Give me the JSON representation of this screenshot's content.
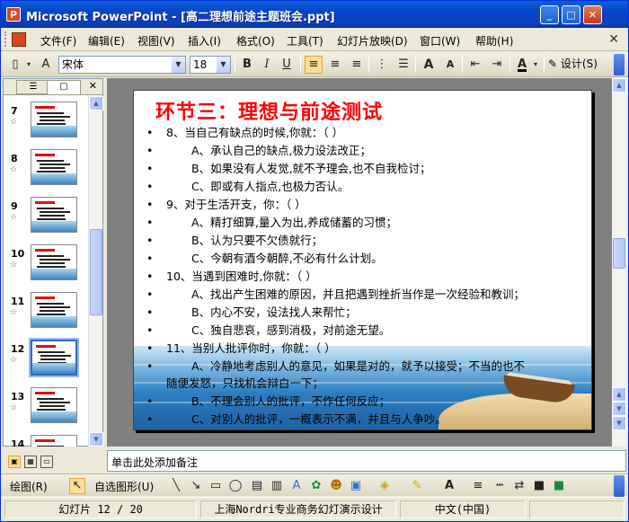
{
  "window": {
    "title": "Microsoft PowerPoint - [高二理想前途主题班会.ppt]",
    "controls": {
      "minimize": "_",
      "restore": "□",
      "close": "✕"
    }
  },
  "menu": {
    "items": [
      "文件(F)",
      "编辑(E)",
      "视图(V)",
      "插入(I)",
      "格式(O)",
      "工具(T)",
      "幻灯片放映(D)",
      "窗口(W)",
      "帮助(H)"
    ],
    "close_doc": "✕"
  },
  "toolbar": {
    "font_name": "宋体",
    "font_size": "18",
    "bold": "B",
    "italic": "I",
    "underline": "U",
    "design_label": "设计(S)"
  },
  "outline_pane": {
    "tab_outline": "☰",
    "tab_slides": "▢",
    "close": "✕",
    "thumbnails": [
      {
        "num": "7"
      },
      {
        "num": "8"
      },
      {
        "num": "9"
      },
      {
        "num": "10"
      },
      {
        "num": "11"
      },
      {
        "num": "12",
        "selected": true
      },
      {
        "num": "13"
      },
      {
        "num": "14"
      }
    ]
  },
  "slide": {
    "title": "环节三：理想与前途测试",
    "lines": [
      {
        "bullet": "•",
        "indent": 0,
        "text": "8、当自己有缺点的时候,你就：（  ）"
      },
      {
        "bullet": "•",
        "indent": 1,
        "text": "A、承认自己的缺点,极力设法改正；"
      },
      {
        "bullet": "•",
        "indent": 1,
        "text": "B、如果没有人发觉,就不予理会,也不自我检讨；"
      },
      {
        "bullet": "•",
        "indent": 1,
        "text": "C、即或有人指点,也极力否认。"
      },
      {
        "bullet": "•",
        "indent": 0,
        "text": "9、对于生活开支，你：（  ）"
      },
      {
        "bullet": "•",
        "indent": 1,
        "text": "A、精打细算,量入为出,养成储蓄的习惯；"
      },
      {
        "bullet": "•",
        "indent": 1,
        "text": "B、认为只要不欠债就行；"
      },
      {
        "bullet": "•",
        "indent": 1,
        "text": "C、今朝有酒今朝醉,不必有什么计划。"
      },
      {
        "bullet": "•",
        "indent": 0,
        "text": "10、当遇到困难时,你就：（  ）"
      },
      {
        "bullet": "•",
        "indent": 1,
        "text": "A、找出产生困难的原因，并且把遇到挫折当作是一次经验和教训；"
      },
      {
        "bullet": "•",
        "indent": 1,
        "text": "B、内心不安，设法找人来帮忙；"
      },
      {
        "bullet": "•",
        "indent": 1,
        "text": "C、独自悲哀，感到消极，对前途无望。"
      },
      {
        "bullet": "•",
        "indent": 0,
        "text": "11、当别人批评你时，你就：（  ）"
      },
      {
        "bullet": "•",
        "indent": 1,
        "text": "A、冷静地考虑别人的意见，如果是对的，就予以接受；不当的也不",
        "cont": "随便发怒，只找机会辩白一下；"
      },
      {
        "bullet": "•",
        "indent": 1,
        "text": "B、不理会别人的批评，不作任何反应；"
      },
      {
        "bullet": "•",
        "indent": 1,
        "text": "C、对别人的批评，一概表示不满，并且与人争吵。"
      }
    ]
  },
  "notes": {
    "placeholder": "单击此处添加备注"
  },
  "drawbar": {
    "draw_label": "绘图(R)",
    "autoshape_label": "自选图形(U)"
  },
  "status": {
    "slide_info": "幻灯片 12 / 20",
    "template": "上海Nordri专业商务幻灯演示设计",
    "language": "中文(中国)"
  }
}
